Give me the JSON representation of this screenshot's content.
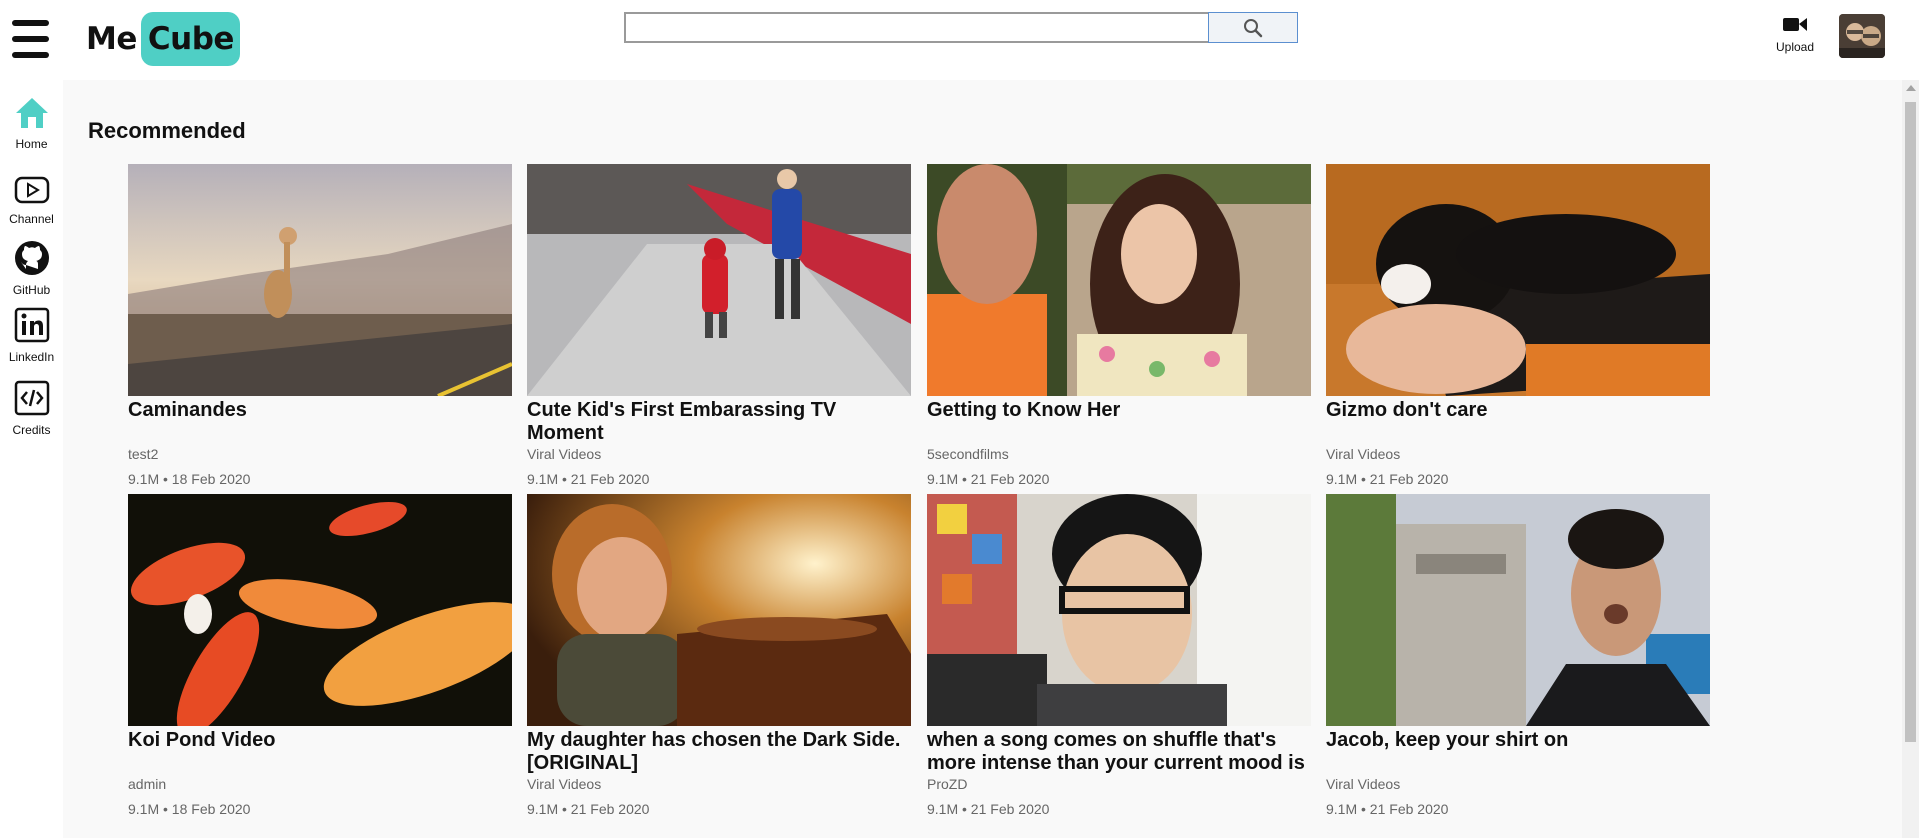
{
  "header": {
    "logo_me": "Me",
    "logo_cube": "Cube",
    "search_placeholder": "",
    "upload_label": "Upload"
  },
  "sidebar": {
    "items": [
      {
        "label": "Home",
        "icon": "home-icon"
      },
      {
        "label": "Channel",
        "icon": "channel-icon"
      },
      {
        "label": "GitHub",
        "icon": "github-icon"
      },
      {
        "label": "LinkedIn",
        "icon": "linkedin-icon"
      },
      {
        "label": "Credits",
        "icon": "code-icon"
      }
    ]
  },
  "main": {
    "section_title": "Recommended",
    "videos": [
      {
        "title": "Caminandes",
        "channel": "test2",
        "meta": "9.1M • 18 Feb 2020"
      },
      {
        "title": "Cute Kid's First Embarassing TV Moment",
        "channel": "Viral Videos",
        "meta": "9.1M • 21 Feb 2020"
      },
      {
        "title": "Getting to Know Her",
        "channel": "5secondfilms",
        "meta": "9.1M • 21 Feb 2020"
      },
      {
        "title": "Gizmo don't care",
        "channel": "Viral Videos",
        "meta": "9.1M • 21 Feb 2020"
      },
      {
        "title": "Koi Pond Video",
        "channel": "admin",
        "meta": "9.1M • 18 Feb 2020"
      },
      {
        "title": "My daughter has chosen the Dark Side. [ORIGINAL]",
        "channel": "Viral Videos",
        "meta": "9.1M • 21 Feb 2020"
      },
      {
        "title": "when a song comes on shuffle that's more intense than your current mood is",
        "channel": "ProZD",
        "meta": "9.1M • 21 Feb 2020"
      },
      {
        "title": "Jacob, keep your shirt on",
        "channel": "Viral Videos",
        "meta": "9.1M • 21 Feb 2020"
      }
    ]
  },
  "colors": {
    "brand": "#4fcfc5",
    "home_icon": "#4fcfc5",
    "page_bg": "#f9f9f9"
  }
}
